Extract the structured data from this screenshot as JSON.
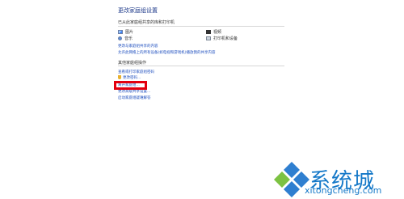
{
  "page": {
    "title": "更改家庭组设置"
  },
  "libraries": {
    "heading": "已从此家庭组共享的库和打印机",
    "items": [
      {
        "label": "图片",
        "icon": "pictures-icon"
      },
      {
        "label": "视频",
        "icon": "videos-icon"
      },
      {
        "label": "音乐",
        "icon": "music-icon"
      },
      {
        "label": "打印机和设备",
        "icon": "printer-icon"
      }
    ],
    "link_change": "更改与家庭组共享的内容",
    "link_media": "允许此网络上的所有设备(如电视和游戏机)播放我的共享内容"
  },
  "other": {
    "heading": "其他家庭组操作",
    "links": [
      {
        "label": "查看或打印家庭组密码"
      },
      {
        "label": "更改密码..."
      },
      {
        "label": "离开家庭组..."
      },
      {
        "label": "更改高级共享设置..."
      },
      {
        "label": "启动家庭组疑难解答"
      }
    ]
  },
  "watermark": {
    "brand": "系统城",
    "url": "xitongcheng.com",
    "color": "#1478c8"
  }
}
